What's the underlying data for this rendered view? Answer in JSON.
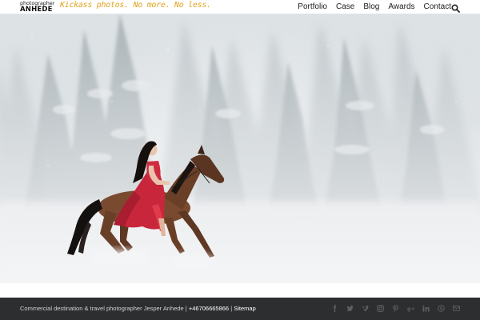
{
  "header": {
    "logo_small": "photographer",
    "logo_big": "ANHEDE",
    "tagline": "Kickass photos. No more. No less.",
    "nav": [
      "Portfolio",
      "Case",
      "Blog",
      "Awards",
      "Contact"
    ]
  },
  "hero": {
    "description": "hero-photo"
  },
  "footer": {
    "text": "Commercial destination & travel photographer Jesper Anhede",
    "phone": "+46706665866",
    "sitemap": "Sitemap",
    "social_icons": [
      "facebook-icon",
      "twitter-icon",
      "vimeo-icon",
      "instagram-icon",
      "pinterest-icon",
      "google-plus-icon",
      "linkedin-icon",
      "skype-icon",
      "email-icon"
    ]
  },
  "colors": {
    "accent": "#e0a31c",
    "footer_bg": "#2c2e30",
    "dress": "#c8263a"
  }
}
